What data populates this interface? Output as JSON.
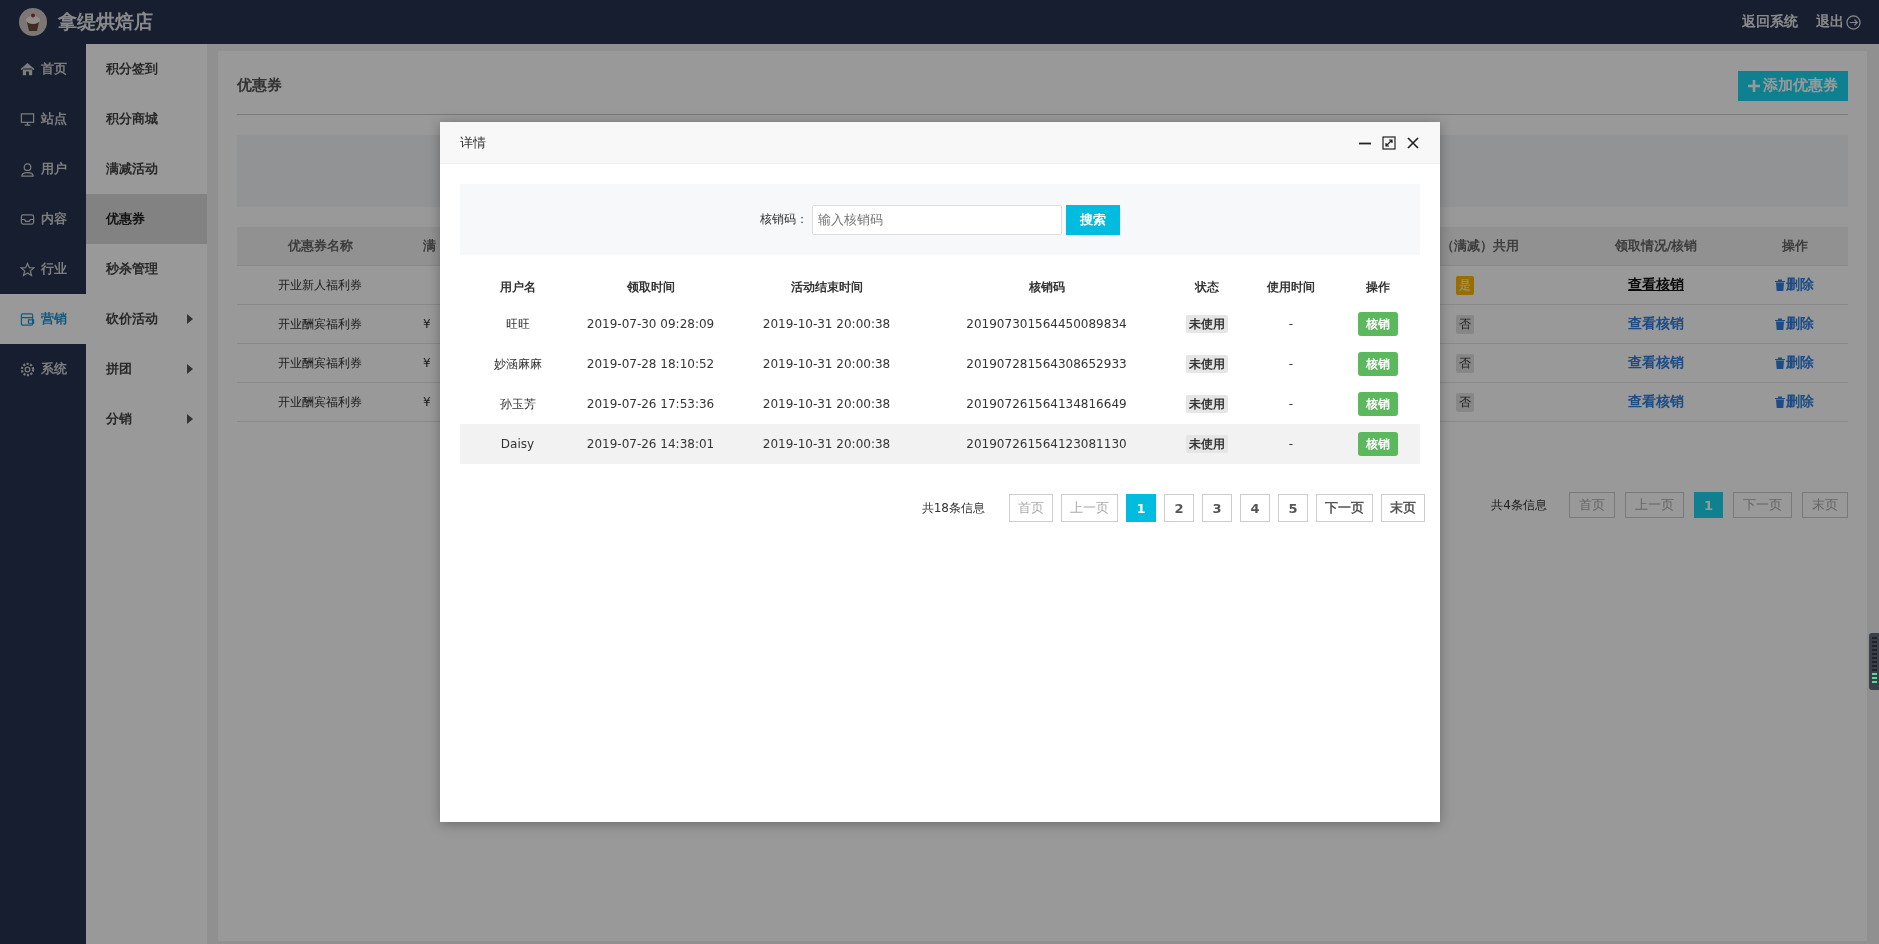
{
  "header": {
    "shop_name": "拿缇烘焙店",
    "links": [
      {
        "label": "返回系统",
        "kind": "text"
      },
      {
        "label": "退出",
        "kind": "logout"
      }
    ]
  },
  "nav": [
    {
      "label": "首页",
      "selected": false
    },
    {
      "label": "站点",
      "selected": false
    },
    {
      "label": "用户",
      "selected": false
    },
    {
      "label": "内容",
      "selected": false
    },
    {
      "label": "行业",
      "selected": false
    },
    {
      "label": "营销",
      "selected": true
    },
    {
      "label": "系统",
      "selected": false
    }
  ],
  "subnav": [
    {
      "label": "积分签到",
      "selected": false,
      "has_children": false
    },
    {
      "label": "积分商城",
      "selected": false,
      "has_children": false
    },
    {
      "label": "满减活动",
      "selected": false,
      "has_children": false
    },
    {
      "label": "优惠券",
      "selected": true,
      "has_children": false
    },
    {
      "label": "秒杀管理",
      "selected": false,
      "has_children": false
    },
    {
      "label": "砍价活动",
      "selected": false,
      "has_children": true
    },
    {
      "label": "拼团",
      "selected": false,
      "has_children": true
    },
    {
      "label": "分销",
      "selected": false,
      "has_children": true
    }
  ],
  "page": {
    "title": "优惠券",
    "add_button": "添加优惠券",
    "table": {
      "columns": [
        "优惠券名称",
        "满",
        "（满减）共用",
        "领取情况/核销",
        "操作"
      ],
      "rows": [
        {
          "name": "开业新人福利券",
          "column_2": "",
          "shared": "是",
          "shared_yes": true,
          "link": "查看核销",
          "hover": true,
          "action": "删除"
        },
        {
          "name": "开业酬宾福利券",
          "column_2": "¥",
          "shared": "否",
          "shared_yes": false,
          "link": "查看核销",
          "hover": false,
          "action": "删除"
        },
        {
          "name": "开业酬宾福利券",
          "column_2": "¥",
          "shared": "否",
          "shared_yes": false,
          "link": "查看核销",
          "hover": false,
          "action": "删除"
        },
        {
          "name": "开业酬宾福利券",
          "column_2": "¥",
          "shared": "否",
          "shared_yes": false,
          "link": "查看核销",
          "hover": false,
          "action": "删除"
        }
      ]
    },
    "pagination": {
      "total": "共4条信息",
      "items": [
        {
          "label": "首页",
          "selected": false,
          "disabled": true
        },
        {
          "label": "上一页",
          "selected": false,
          "disabled": true
        },
        {
          "label": "1",
          "selected": true,
          "disabled": false
        },
        {
          "label": "下一页",
          "selected": false,
          "disabled": true
        },
        {
          "label": "末页",
          "selected": false,
          "disabled": true
        }
      ]
    }
  },
  "dialog": {
    "title": "详情",
    "search": {
      "label": "核销码：",
      "placeholder": "输入核销码",
      "button": "搜索"
    },
    "table": {
      "columns": [
        "用户名",
        "领取时间",
        "活动结束时间",
        "核销码",
        "状态",
        "使用时间",
        "操作"
      ],
      "rows": [
        {
          "user": "旺旺",
          "received": "2019-07-30 09:28:09",
          "ends": "2019-10-31 20:00:38",
          "code": "201907301564450089834",
          "status": "未使用",
          "used": "-",
          "action": "核销",
          "highlighted": false
        },
        {
          "user": "妙涵麻麻",
          "received": "2019-07-28 18:10:52",
          "ends": "2019-10-31 20:00:38",
          "code": "201907281564308652933",
          "status": "未使用",
          "used": "-",
          "action": "核销",
          "highlighted": false
        },
        {
          "user": "孙玉芳",
          "received": "2019-07-26 17:53:36",
          "ends": "2019-10-31 20:00:38",
          "code": "201907261564134816649",
          "status": "未使用",
          "used": "-",
          "action": "核销",
          "highlighted": false
        },
        {
          "user": "Daisy",
          "received": "2019-07-26 14:38:01",
          "ends": "2019-10-31 20:00:38",
          "code": "201907261564123081130",
          "status": "未使用",
          "used": "-",
          "action": "核销",
          "highlighted": true
        }
      ]
    },
    "pagination": {
      "total": "共18条信息",
      "items": [
        {
          "label": "首页",
          "selected": false,
          "disabled": true
        },
        {
          "label": "上一页",
          "selected": false,
          "disabled": true
        },
        {
          "label": "1",
          "selected": true,
          "disabled": false
        },
        {
          "label": "2",
          "selected": false,
          "disabled": false
        },
        {
          "label": "3",
          "selected": false,
          "disabled": false
        },
        {
          "label": "4",
          "selected": false,
          "disabled": false
        },
        {
          "label": "5",
          "selected": false,
          "disabled": false
        },
        {
          "label": "下一页",
          "selected": false,
          "disabled": false
        },
        {
          "label": "末页",
          "selected": false,
          "disabled": false
        }
      ]
    }
  }
}
